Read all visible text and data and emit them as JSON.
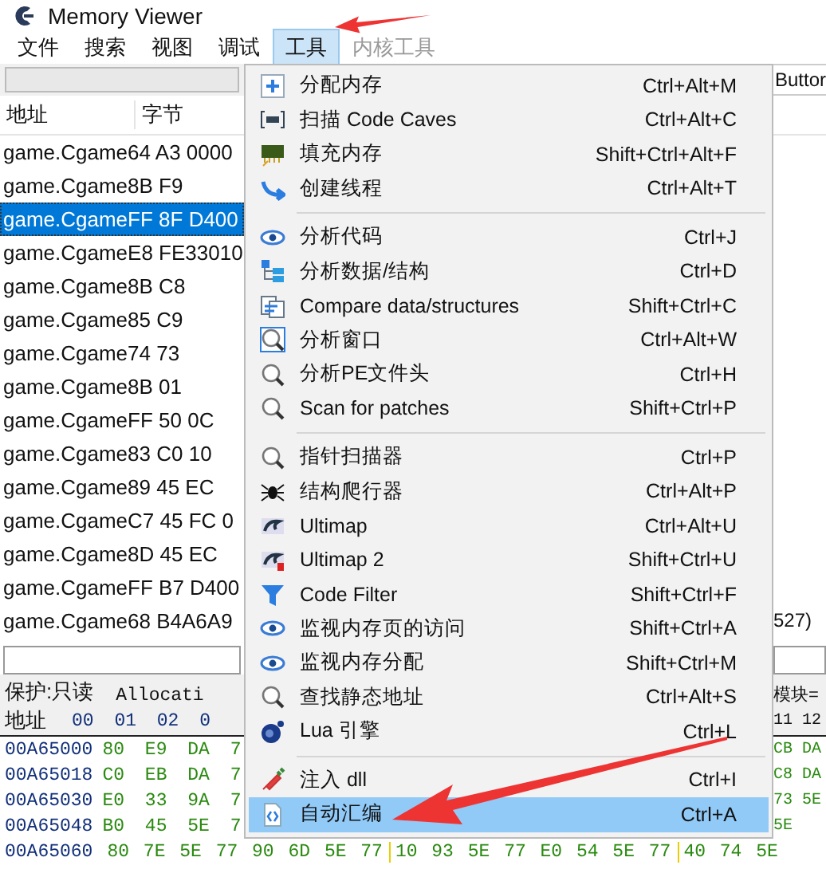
{
  "window": {
    "title": "Memory Viewer"
  },
  "menubar": [
    {
      "label": "文件",
      "selected": false
    },
    {
      "label": "搜索",
      "selected": false
    },
    {
      "label": "视图",
      "selected": false
    },
    {
      "label": "调试",
      "selected": false
    },
    {
      "label": "工具",
      "selected": true
    },
    {
      "label": "内核工具",
      "selected": false
    }
  ],
  "disassembly": {
    "toolbar_button": "Buttor",
    "columns": [
      "地址",
      "字节"
    ],
    "rows": [
      {
        "text": "game.Cgame64 A3 0000",
        "selected": false
      },
      {
        "text": "game.Cgame8B F9",
        "selected": false
      },
      {
        "text": "game.CgameFF 8F D400",
        "selected": true
      },
      {
        "text": "game.CgameE8 FE33010",
        "selected": false
      },
      {
        "text": "game.Cgame8B C8",
        "selected": false
      },
      {
        "text": "game.Cgame85 C9",
        "selected": false
      },
      {
        "text": "game.Cgame74 73",
        "selected": false
      },
      {
        "text": "game.Cgame8B 01",
        "selected": false
      },
      {
        "text": "game.CgameFF 50 0C",
        "selected": false
      },
      {
        "text": "game.Cgame83 C0 10",
        "selected": false
      },
      {
        "text": "game.Cgame89 45 EC",
        "selected": false
      },
      {
        "text": "game.CgameC7 45 FC 0",
        "selected": false
      },
      {
        "text": "game.Cgame8D 45 EC",
        "selected": false
      },
      {
        "text": "game.CgameFF B7 D400",
        "selected": false
      },
      {
        "text": "game.Cgame68 B4A6A9",
        "selected": false,
        "right": "527)"
      }
    ]
  },
  "hex": {
    "protection": "保护:只读",
    "allocation": "Allocati",
    "module": "模块=",
    "address_header": "地址",
    "bytes_header": "00 01 02 0",
    "right_header": "11 12",
    "rows": [
      {
        "address": "00A65000",
        "bytes": "80 E9 DA 7",
        "right": "CB DA"
      },
      {
        "address": "00A65018",
        "bytes": "C0 EB DA 7",
        "right": "C8 DA"
      },
      {
        "address": "00A65030",
        "bytes": "E0 33 9A 7",
        "right": "73 5E"
      },
      {
        "address": "00A65048",
        "bytes": "B0 45 5E 7",
        "right": "5E"
      }
    ],
    "full_row": {
      "address": "00A65060",
      "groups": [
        "80 7E 5E 77 90 6D 5E 77",
        "10 93 5E 77 E0 54 5E 77",
        "40 74 5E"
      ]
    }
  },
  "menu": {
    "items": [
      {
        "kind": "item",
        "label": "分配内存",
        "shortcut": "Ctrl+Alt+M",
        "selected": false
      },
      {
        "kind": "item",
        "label": "扫描 Code Caves",
        "shortcut": "Ctrl+Alt+C",
        "selected": false
      },
      {
        "kind": "item",
        "label": "填充内存",
        "shortcut": "Shift+Ctrl+Alt+F",
        "selected": false
      },
      {
        "kind": "item",
        "label": "创建线程",
        "shortcut": "Ctrl+Alt+T",
        "selected": false
      },
      {
        "kind": "separator"
      },
      {
        "kind": "item",
        "label": "分析代码",
        "shortcut": "Ctrl+J",
        "selected": false
      },
      {
        "kind": "item",
        "label": "分析数据/结构",
        "shortcut": "Ctrl+D",
        "selected": false
      },
      {
        "kind": "item",
        "label": "Compare data/structures",
        "shortcut": "Shift+Ctrl+C",
        "selected": false
      },
      {
        "kind": "item",
        "label": "分析窗口",
        "shortcut": "Ctrl+Alt+W",
        "selected": false
      },
      {
        "kind": "item",
        "label": "分析PE文件头",
        "shortcut": "Ctrl+H",
        "selected": false
      },
      {
        "kind": "item",
        "label": "Scan for patches",
        "shortcut": "Shift+Ctrl+P",
        "selected": false
      },
      {
        "kind": "separator"
      },
      {
        "kind": "item",
        "label": "指针扫描器",
        "shortcut": "Ctrl+P",
        "selected": false
      },
      {
        "kind": "item",
        "label": "结构爬行器",
        "shortcut": "Ctrl+Alt+P",
        "selected": false
      },
      {
        "kind": "item",
        "label": "Ultimap",
        "shortcut": "Ctrl+Alt+U",
        "selected": false
      },
      {
        "kind": "item",
        "label": "Ultimap 2",
        "shortcut": "Shift+Ctrl+U",
        "selected": false
      },
      {
        "kind": "item",
        "label": "Code Filter",
        "shortcut": "Shift+Ctrl+F",
        "selected": false
      },
      {
        "kind": "item",
        "label": "监视内存页的访问",
        "shortcut": "Shift+Ctrl+A",
        "selected": false
      },
      {
        "kind": "item",
        "label": "监视内存分配",
        "shortcut": "Shift+Ctrl+M",
        "selected": false
      },
      {
        "kind": "item",
        "label": "查找静态地址",
        "shortcut": "Ctrl+Alt+S",
        "selected": false
      },
      {
        "kind": "item",
        "label": "Lua 引擎",
        "shortcut": "Ctrl+L",
        "selected": false
      },
      {
        "kind": "separator"
      },
      {
        "kind": "item",
        "label": "注入 dll",
        "shortcut": "Ctrl+I",
        "selected": false
      },
      {
        "kind": "item",
        "label": "自动汇编",
        "shortcut": "Ctrl+A",
        "selected": true
      }
    ]
  }
}
